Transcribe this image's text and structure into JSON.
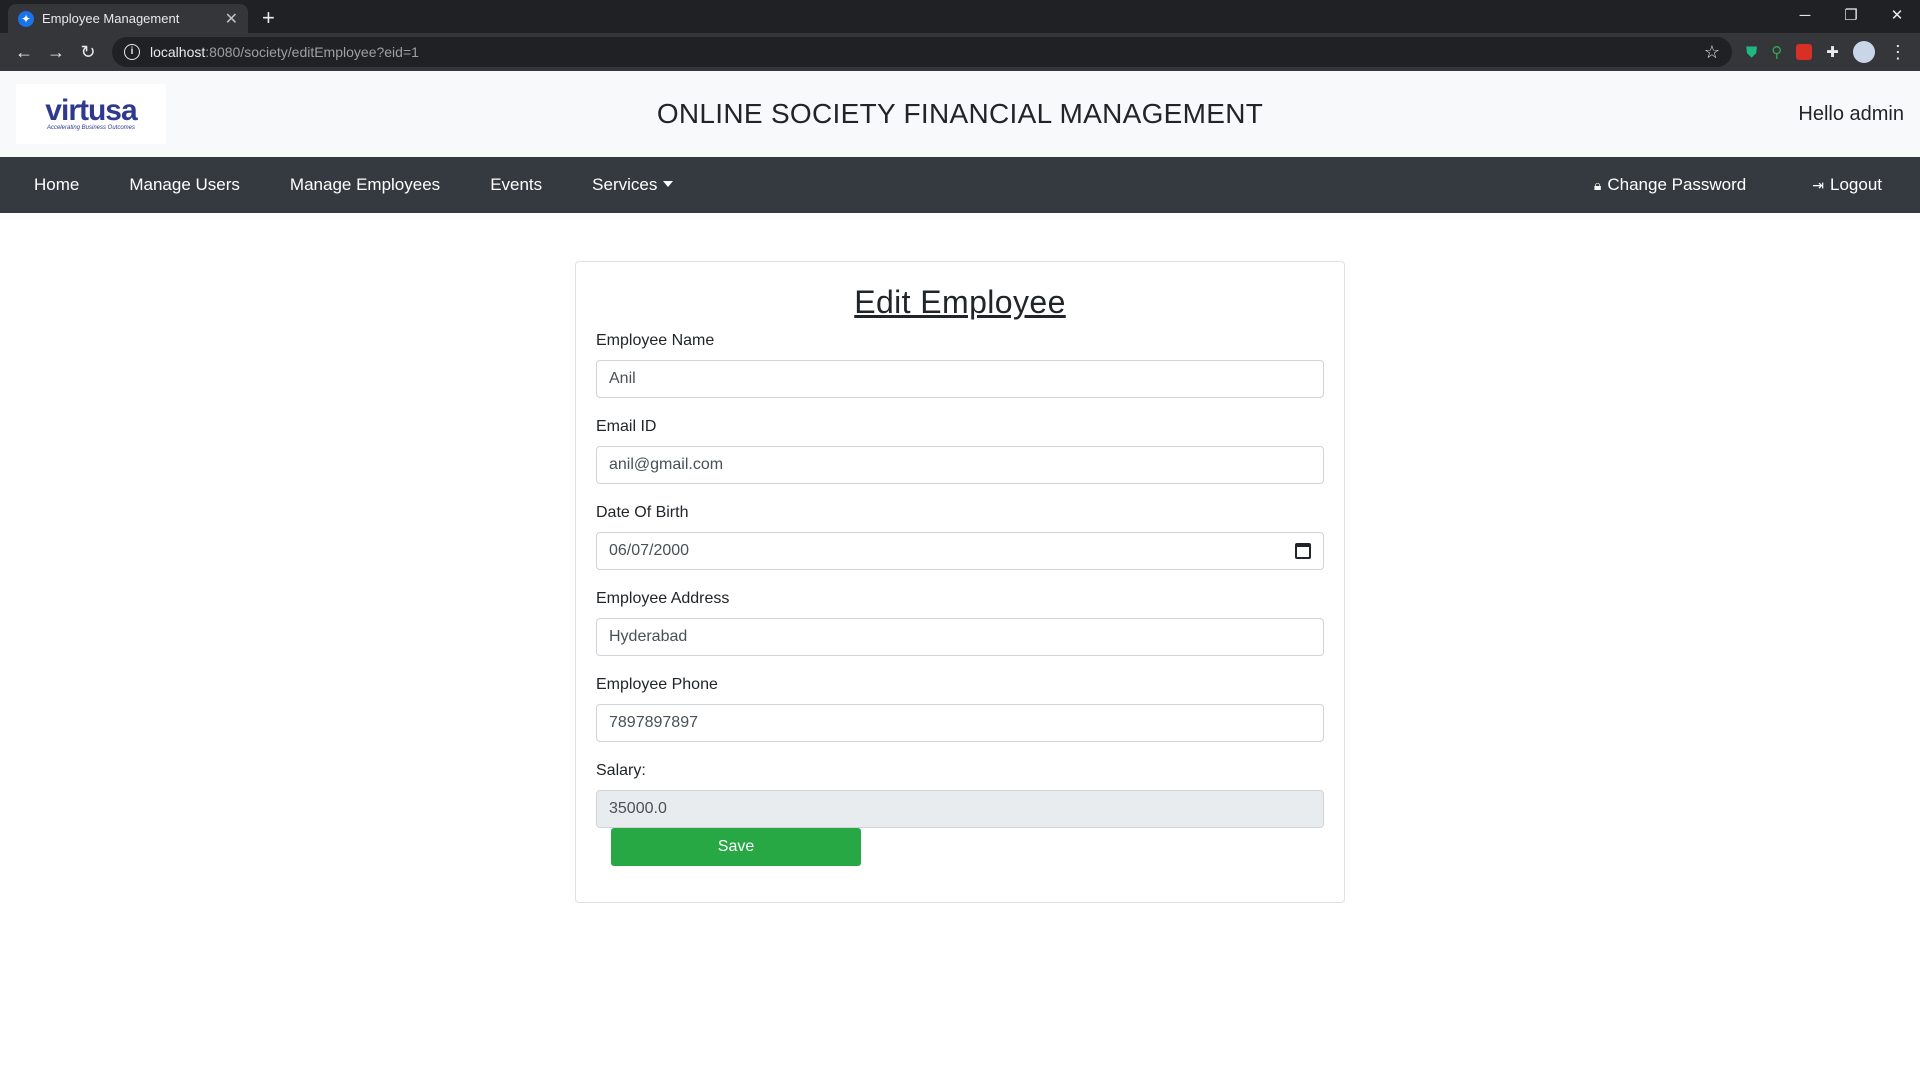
{
  "browser": {
    "tab_title": "Employee Management",
    "url_host": "localhost",
    "url_path": ":8080/society/editEmployee?eid=1"
  },
  "header": {
    "logo_text": "virtusa",
    "logo_tagline": "Accelerating Business Outcomes",
    "site_title": "ONLINE SOCIETY FINANCIAL MANAGEMENT",
    "greeting": "Hello admin"
  },
  "nav": {
    "items": [
      {
        "label": "Home"
      },
      {
        "label": "Manage Users"
      },
      {
        "label": "Manage Employees"
      },
      {
        "label": "Events"
      },
      {
        "label": "Services"
      }
    ],
    "change_password": "Change Password",
    "logout": "Logout"
  },
  "form": {
    "title": "Edit Employee",
    "name": {
      "label": "Employee Name",
      "value": "Anil"
    },
    "email": {
      "label": "Email ID",
      "value": "anil@gmail.com"
    },
    "dob": {
      "label": "Date Of Birth",
      "value": "06/07/2000"
    },
    "address": {
      "label": "Employee Address",
      "value": "Hyderabad"
    },
    "phone": {
      "label": "Employee Phone",
      "value": "7897897897"
    },
    "salary": {
      "label": "Salary:",
      "value": "35000.0"
    },
    "save_label": "Save"
  },
  "colors": {
    "nav_bg": "#343a40",
    "save_button": "#28a745",
    "header_bg": "#f8f9fa"
  }
}
